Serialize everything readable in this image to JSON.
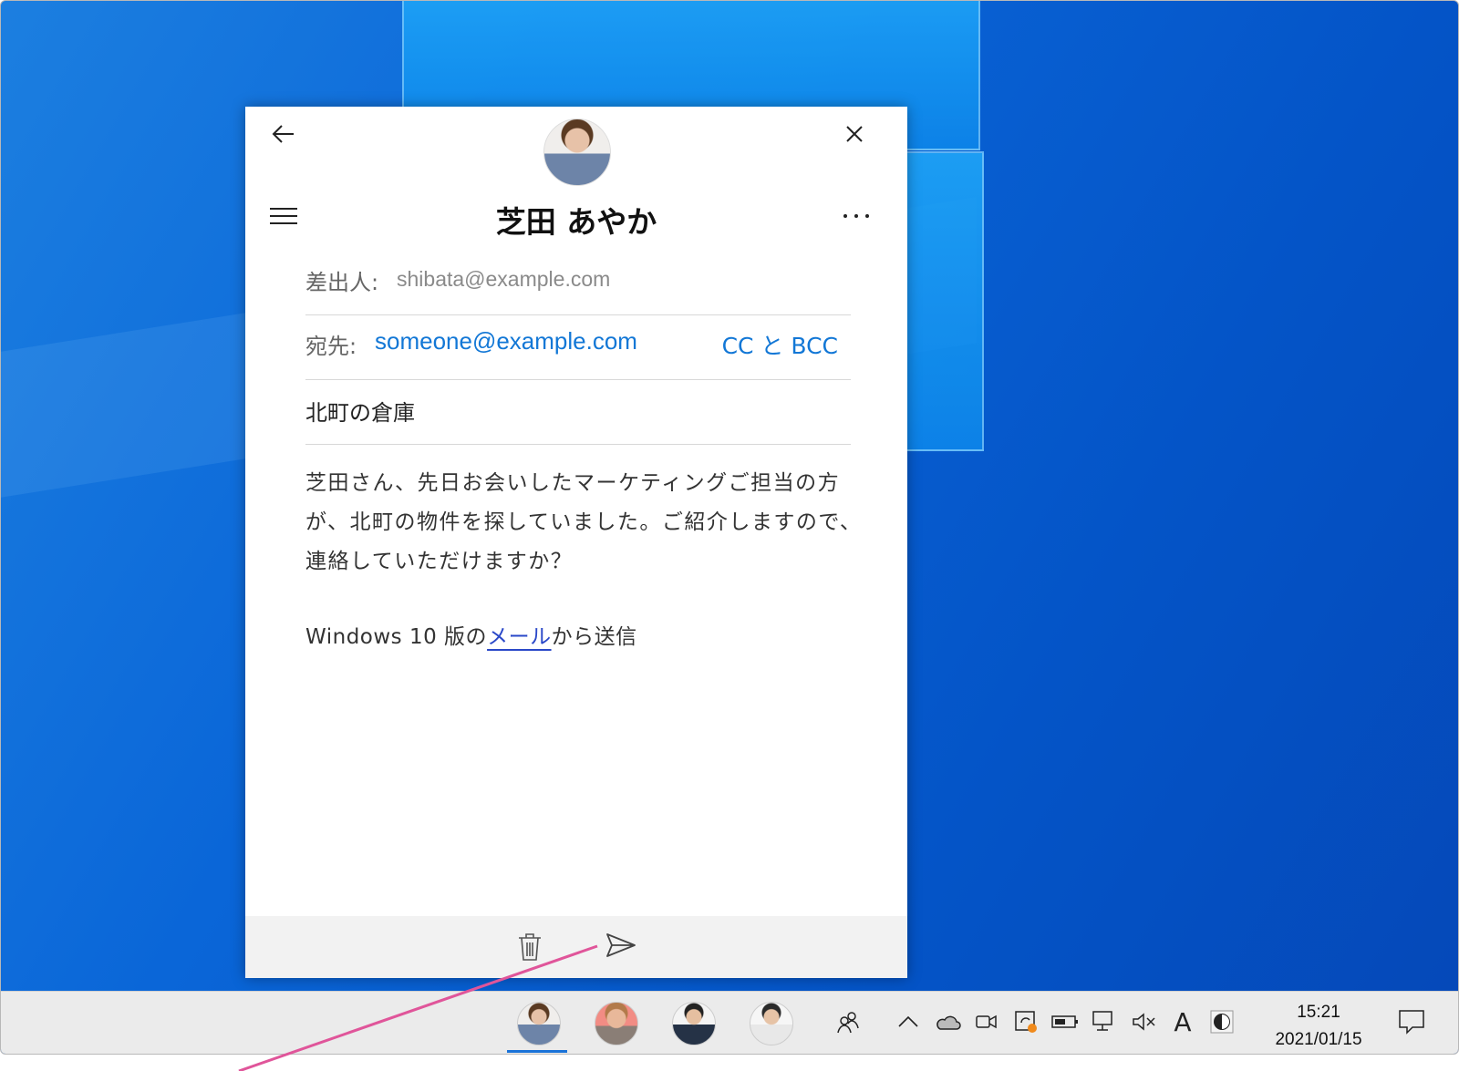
{
  "mail": {
    "sender_name": "芝田 あやか",
    "from_label": "差出人:",
    "from_address": "shibata@example.com",
    "to_label": "宛先:",
    "to_address": "someone@example.com",
    "cc_bcc_label": "CC と BCC",
    "subject": "北町の倉庫",
    "body_line1": "芝田さん、先日お会いしたマーケティングご担当の方",
    "body_line2": "が、北町の物件を探していました。ご紹介しますので、",
    "body_line3": "連絡していただけますか？",
    "signature_prefix": "Windows 10 版の",
    "signature_link": "メール",
    "signature_suffix": "から送信"
  },
  "icons": {
    "back": "back-arrow-icon",
    "close": "close-icon",
    "menu": "hamburger-menu-icon",
    "more": "more-options-icon",
    "trash": "trash-icon",
    "send": "send-icon"
  },
  "taskbar": {
    "time": "15:21",
    "date": "2021/01/15",
    "ime_indicator": "A"
  },
  "colors": {
    "accent": "#1277d6",
    "link": "#2a48c8",
    "annotation": "#e0559a"
  }
}
